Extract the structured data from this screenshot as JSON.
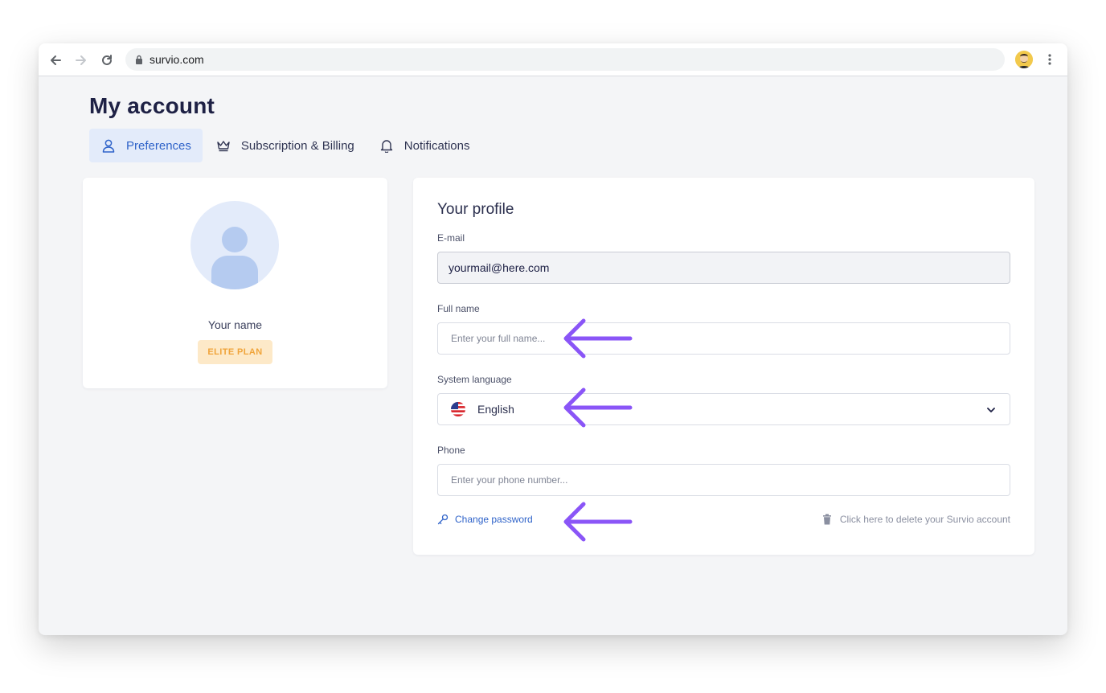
{
  "browser": {
    "url": "survio.com"
  },
  "page": {
    "title": "My account"
  },
  "tabs": [
    {
      "label": "Preferences",
      "active": true,
      "icon": "user-icon"
    },
    {
      "label": "Subscription & Billing",
      "active": false,
      "icon": "crown-icon"
    },
    {
      "label": "Notifications",
      "active": false,
      "icon": "bell-icon"
    }
  ],
  "profile_card": {
    "name": "Your name",
    "plan": "ELITE PLAN"
  },
  "form": {
    "title": "Your profile",
    "email_label": "E-mail",
    "email_value": "yourmail@here.com",
    "fullname_label": "Full name",
    "fullname_placeholder": "Enter your full name...",
    "language_label": "System language",
    "language_value": "English",
    "phone_label": "Phone",
    "phone_placeholder": "Enter your phone number...",
    "change_password": "Change password",
    "delete_account": "Click here to delete your Survio account"
  },
  "colors": {
    "accent": "#2f63c9",
    "annotation_arrow": "#8a55f7",
    "plan_badge_bg": "#fde9c8",
    "plan_badge_text": "#f0a43a"
  }
}
